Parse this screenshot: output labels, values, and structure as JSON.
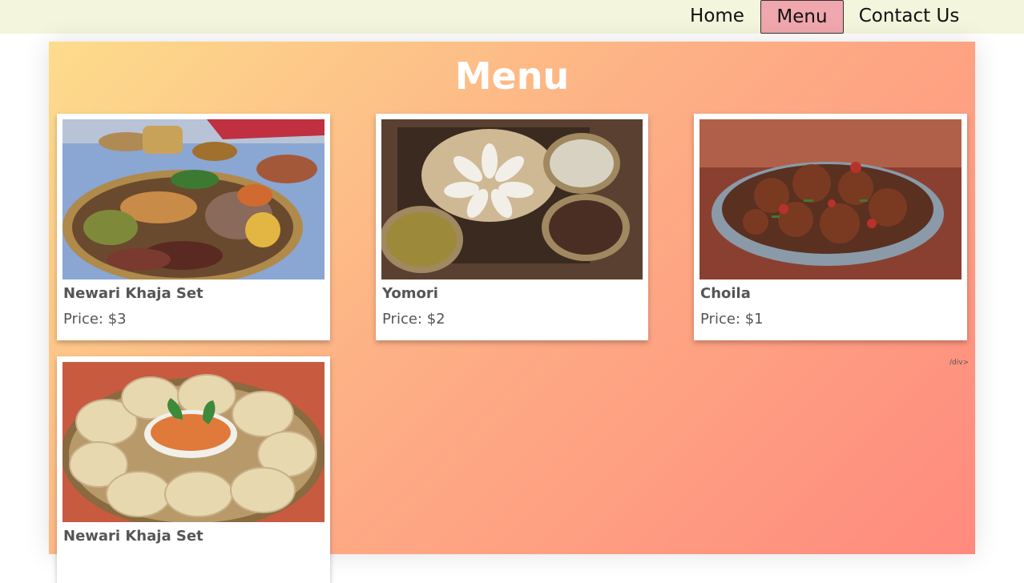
{
  "nav": {
    "items": [
      {
        "label": "Home"
      },
      {
        "label": "Menu"
      },
      {
        "label": "Contact Us"
      }
    ]
  },
  "page": {
    "title": "Menu",
    "stray_text": "/div>"
  },
  "menu_items": [
    {
      "name": "Newari Khaja Set",
      "price": "Price: $3",
      "image": "newari-khaja-platter"
    },
    {
      "name": "Yomori",
      "price": "Price: $2",
      "image": "yomari-dumplings"
    },
    {
      "name": "Choila",
      "price": "Price: $1",
      "image": "choila-spiced-meat"
    },
    {
      "name": "Newari Khaja Set",
      "price": "",
      "image": "momo-dumplings"
    }
  ],
  "colors": {
    "navbar_bg": "#f3f6dc",
    "active_nav_bg": "#f0a7ad",
    "gradient_start": "#fddc8c",
    "gradient_end": "#ff8a7e"
  }
}
